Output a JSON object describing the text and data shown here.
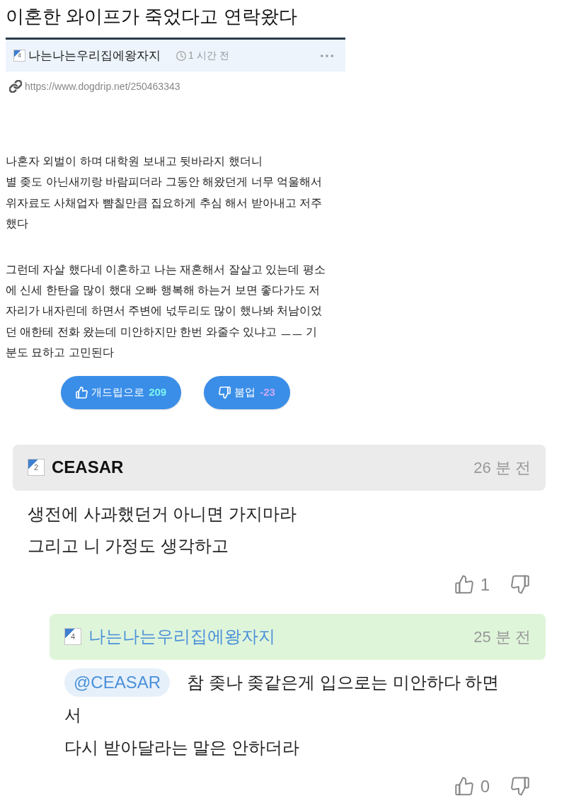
{
  "post": {
    "title": "이혼한 와이프가 죽었다고 연락왔다",
    "author": {
      "rank": "4",
      "name": "나는나는우리집에왕자지"
    },
    "time": "1 시간 전",
    "url": "https://www.dogdrip.net/250463343",
    "paragraphs": [
      {
        "lines": [
          "나혼자 외벌이 하며 대학원 보내고 뒷바라지 했더니",
          "별 좆도 아닌새끼랑 바람피더라 그동안 해왔던게 너무 억울해서",
          "위자료도 사채업자 뺨칠만큼 집요하게 추심 해서 받아내고 저주",
          "했다"
        ]
      },
      {
        "lines": [
          "그런데 자살 했다네 이혼하고 나는 재혼해서 잘살고 있는데 평소",
          "에 신세 한탄을 많이 했대 오빠 행복해 하는거 보면 좋다가도 저",
          "자리가 내자린데 하면서 주변에 넋두리도 많이 했나봐 처남이었",
          "던 애한테 전화 왔는데 미안하지만 한번 와줄수 있냐고 ㅡㅡ 기",
          "분도 묘하고 고민된다"
        ]
      }
    ],
    "votes": [
      {
        "kind": "up",
        "label": "개드립으로",
        "count": "209"
      },
      {
        "kind": "down",
        "label": "붐업",
        "count": "-23"
      }
    ]
  },
  "comments": [
    {
      "rank": "2",
      "author": "CEASAR",
      "time": "26 분 전",
      "by_post_author": false,
      "reply": false,
      "lines": [
        "생전에 사과했던거 아니면 가지마라",
        "그리고 니 가정도 생각하고"
      ],
      "likes": "1"
    },
    {
      "rank": "4",
      "author": "나는나는우리집에왕자지",
      "time": "25 분 전",
      "by_post_author": true,
      "reply": true,
      "mention": "@CEASAR",
      "lines": [
        "참 좆나 좆같은게 입으로는 미안하다 하면",
        "서",
        "다시 받아달라는 말은 안하더라"
      ],
      "likes": "0"
    }
  ]
}
